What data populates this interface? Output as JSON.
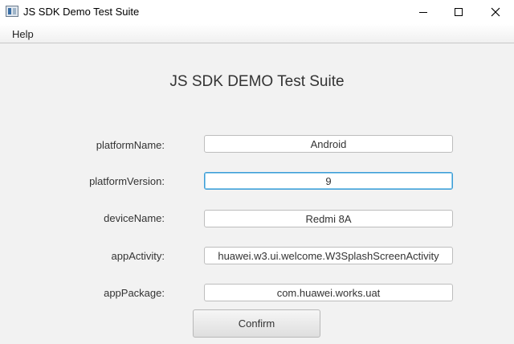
{
  "window": {
    "title": "JS SDK Demo Test Suite",
    "controls": {
      "minimize": "minimize-icon",
      "maximize": "maximize-icon",
      "close": "close-icon"
    }
  },
  "menu": {
    "items": [
      {
        "label": "Help"
      }
    ]
  },
  "form": {
    "heading": "JS SDK DEMO Test Suite",
    "fields": [
      {
        "label": "platformName:",
        "value": "Android"
      },
      {
        "label": "platformVersion:",
        "value": "9"
      },
      {
        "label": "deviceName:",
        "value": "Redmi 8A"
      },
      {
        "label": "appActivity:",
        "value": "huawei.w3.ui.welcome.W3SplashScreenActivity"
      },
      {
        "label": "appPackage:",
        "value": "com.huawei.works.uat"
      }
    ],
    "confirm_label": "Confirm"
  },
  "colors": {
    "focus_border": "#3c9cd6",
    "background": "#f2f2f2"
  }
}
